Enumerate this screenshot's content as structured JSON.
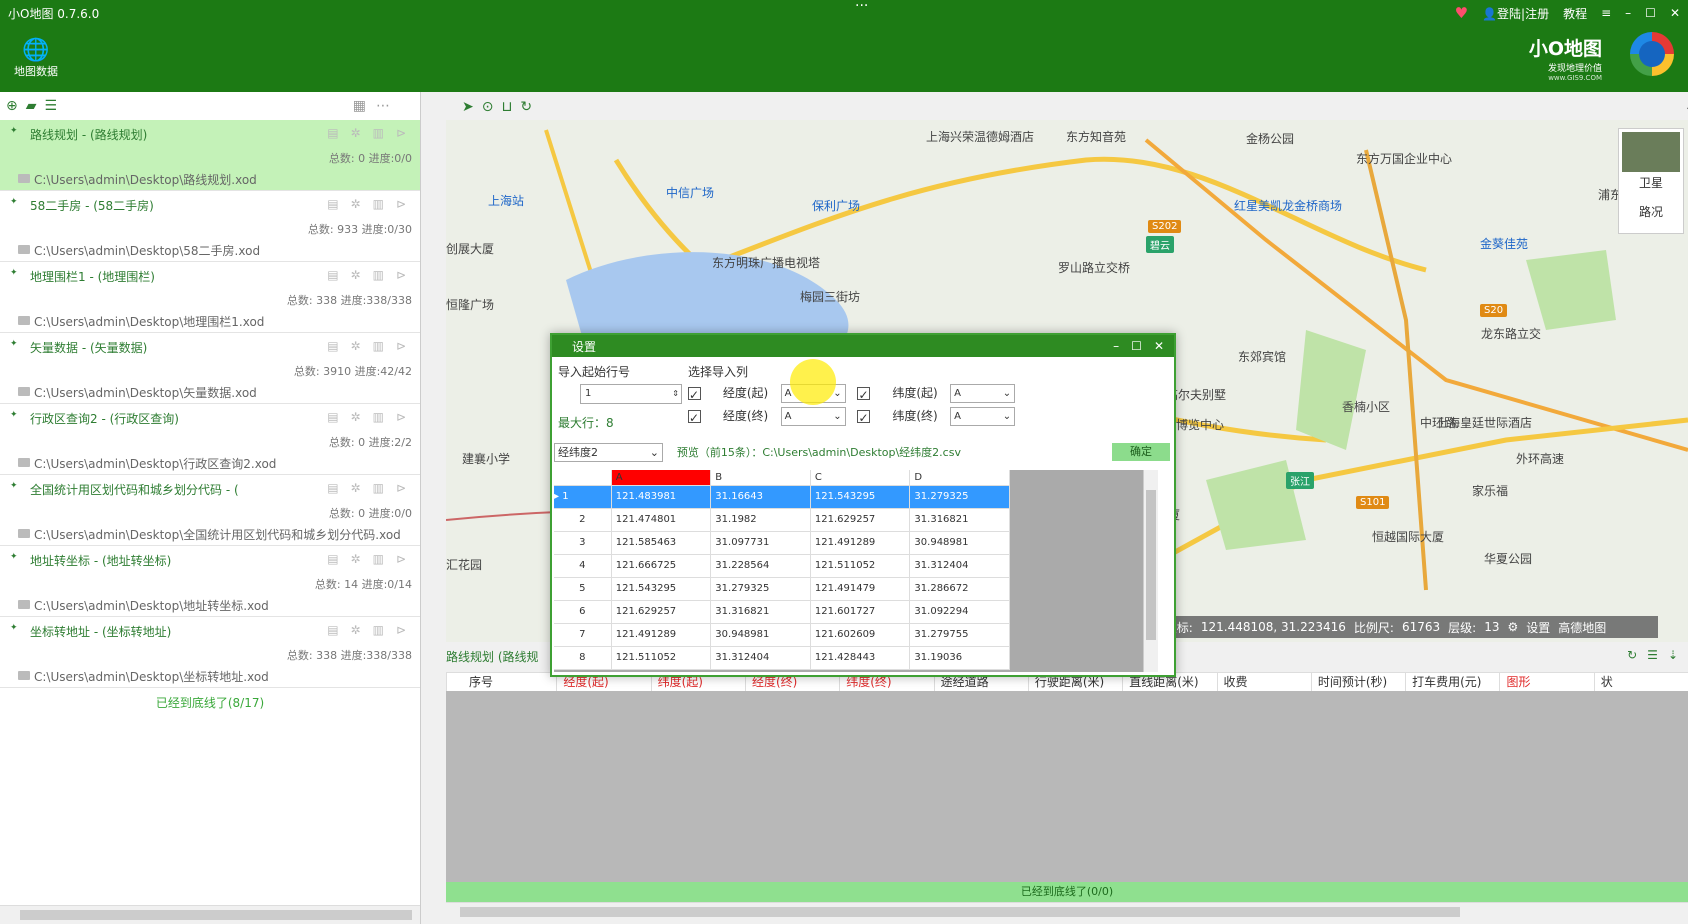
{
  "app": {
    "title": "小O地图 0.7.6.0",
    "drag_dots": "···"
  },
  "topbar": {
    "login_label": "登陆|注册",
    "tutorial_label": "教程",
    "globe_label": "地图数据"
  },
  "brand": {
    "name": "小O地图",
    "slogan": "发现地理价值",
    "url": "www.GIS9.COM"
  },
  "layers": [
    {
      "title": "路线规划 - (路线规划)",
      "stats": "总数: 0 进度:0/0",
      "path": "C:\\Users\\admin\\Desktop\\路线规划.xod"
    },
    {
      "title": "58二手房 - (58二手房)",
      "stats": "总数: 933 进度:0/30",
      "path": "C:\\Users\\admin\\Desktop\\58二手房.xod"
    },
    {
      "title": "地理围栏1 - (地理围栏)",
      "stats": "总数: 338 进度:338/338",
      "path": "C:\\Users\\admin\\Desktop\\地理围栏1.xod"
    },
    {
      "title": "矢量数据 - (矢量数据)",
      "stats": "总数: 3910 进度:42/42",
      "path": "C:\\Users\\admin\\Desktop\\矢量数据.xod"
    },
    {
      "title": "行政区查询2 - (行政区查询)",
      "stats": "总数: 0 进度:2/2",
      "path": "C:\\Users\\admin\\Desktop\\行政区查询2.xod"
    },
    {
      "title": "全国统计用区划代码和城乡划分代码 - (",
      "stats": "总数: 0 进度:0/0",
      "path": "C:\\Users\\admin\\Desktop\\全国统计用区划代码和城乡划分代码.xod"
    },
    {
      "title": "地址转坐标 - (地址转坐标)",
      "stats": "总数: 14 进度:0/14",
      "path": "C:\\Users\\admin\\Desktop\\地址转坐标.xod"
    },
    {
      "title": "坐标转地址 - (坐标转地址)",
      "stats": "总数: 338 进度:338/338",
      "path": "C:\\Users\\admin\\Desktop\\坐标转地址.xod"
    }
  ],
  "layers_end": "已经到底线了(8/17)",
  "map": {
    "labels": [
      "东方知音苑",
      "金杨公园",
      "东方万国企业中心",
      "上海兴荣温德姆酒店",
      "中信广场",
      "保利广场",
      "上海站",
      "东方明珠广播电视塔",
      "梅园三街坊",
      "罗山路立交桥",
      "红星美凯龙金桥商场",
      "金葵佳苑",
      "浦东金",
      "创展大厦",
      "恒隆广场",
      "东郊宾馆",
      "汤臣高尔夫别墅",
      "香楠小区",
      "龙东路立交",
      "上海皇廷世际酒店",
      "建襄小学",
      "家乐福",
      "畅星大厦",
      "恒越国际大厦",
      "华夏公园",
      "汇花园",
      "上海新国际博览中心",
      "中环路",
      "外环高速"
    ],
    "badges": [
      "S202",
      "碧云",
      "S20",
      "张江",
      "S101"
    ],
    "sat_label": "卫星",
    "traffic_label": "路况",
    "coord_label": "坐标:",
    "coord_value": "121.448108, 31.223416",
    "scale_label": "比例尺:",
    "scale_value": "61763",
    "level_label": "层级:",
    "level_value": "13",
    "settings_label": "设置",
    "provider": "高德地图"
  },
  "dialog": {
    "title": "设置",
    "start_row_label": "导入起始行号",
    "start_row_value": "1",
    "max_row_label": "最大行：8",
    "columns_group_label": "选择导入列",
    "lng_start_label": "经度(起)",
    "lat_start_label": "纬度(起)",
    "lng_end_label": "经度(终)",
    "lat_end_label": "纬度(终)",
    "lng_start_value": "A",
    "lat_start_value": "A",
    "lng_end_value": "A",
    "lat_end_value": "A",
    "sheet_value": "经纬度2",
    "preview_text": "预览（前15条）：C:\\Users\\admin\\Desktop\\经纬度2.csv",
    "confirm_label": "确定",
    "grid_headers": [
      "",
      "A",
      "B",
      "C",
      "D"
    ],
    "grid_rows": [
      [
        "1",
        "121.483981",
        "31.16643",
        "121.543295",
        "31.279325"
      ],
      [
        "2",
        "121.474801",
        "31.1982",
        "121.629257",
        "31.316821"
      ],
      [
        "3",
        "121.585463",
        "31.097731",
        "121.491289",
        "30.948981"
      ],
      [
        "4",
        "121.666725",
        "31.228564",
        "121.511052",
        "31.312404"
      ],
      [
        "5",
        "121.543295",
        "31.279325",
        "121.491479",
        "31.286672"
      ],
      [
        "6",
        "121.629257",
        "31.316821",
        "121.601727",
        "31.092294"
      ],
      [
        "7",
        "121.491289",
        "30.948981",
        "121.602609",
        "31.279755"
      ],
      [
        "8",
        "121.511052",
        "31.312404",
        "121.428443",
        "31.19036"
      ]
    ]
  },
  "bottom": {
    "route_tab": "路线规划 (路线规",
    "columns": [
      {
        "label": "序号",
        "red": false
      },
      {
        "label": "经度(起)",
        "red": true
      },
      {
        "label": "纬度(起)",
        "red": true
      },
      {
        "label": "经度(终)",
        "red": true
      },
      {
        "label": "纬度(终)",
        "red": true
      },
      {
        "label": "途经道路",
        "red": false
      },
      {
        "label": "行驶距离(米)",
        "red": false
      },
      {
        "label": "直线距离(米)",
        "red": false
      },
      {
        "label": "收费",
        "red": false
      },
      {
        "label": "时间预计(秒)",
        "red": false
      },
      {
        "label": "打车费用(元)",
        "red": false
      },
      {
        "label": "图形",
        "red": true
      },
      {
        "label": "状",
        "red": false
      }
    ],
    "status": "已经到底线了(0/0)"
  },
  "colors": {
    "brand_green": "#1c7a14",
    "active_row": "#c4f2b8",
    "selected_row": "#3399ff"
  }
}
